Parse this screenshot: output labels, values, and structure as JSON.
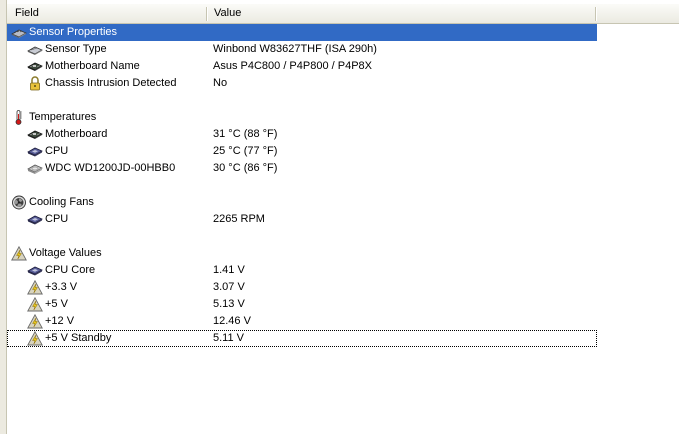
{
  "columns": {
    "field": "Field",
    "value": "Value"
  },
  "groups": [
    {
      "label": "Sensor Properties",
      "icon": "sensor-chip-icon",
      "selected": true,
      "items": [
        {
          "field": "Sensor Type",
          "value": "Winbond W83627THF  (ISA 290h)",
          "icon": "chip-icon"
        },
        {
          "field": "Motherboard Name",
          "value": "Asus P4C800 / P4P800 / P4P8X",
          "icon": "motherboard-icon"
        },
        {
          "field": "Chassis Intrusion Detected",
          "value": "No",
          "icon": "padlock-icon"
        }
      ]
    },
    {
      "label": "Temperatures",
      "icon": "thermometer-icon",
      "items": [
        {
          "field": "Motherboard",
          "value": "31 °C  (88 °F)",
          "icon": "motherboard-icon"
        },
        {
          "field": "CPU",
          "value": "25 °C  (77 °F)",
          "icon": "cpu-icon"
        },
        {
          "field": "WDC WD1200JD-00HBB0",
          "value": "30 °C  (86 °F)",
          "icon": "hard-disk-icon"
        }
      ]
    },
    {
      "label": "Cooling Fans",
      "icon": "fan-icon",
      "items": [
        {
          "field": "CPU",
          "value": "2265 RPM",
          "icon": "cpu-icon"
        }
      ]
    },
    {
      "label": "Voltage Values",
      "icon": "voltage-warning-icon",
      "items": [
        {
          "field": "CPU Core",
          "value": "1.41 V",
          "icon": "cpu-icon"
        },
        {
          "field": "+3.3 V",
          "value": "3.07 V",
          "icon": "voltage-warning-icon"
        },
        {
          "field": "+5 V",
          "value": "5.13 V",
          "icon": "voltage-warning-icon"
        },
        {
          "field": "+12 V",
          "value": "12.46 V",
          "icon": "voltage-warning-icon"
        },
        {
          "field": "+5 V Standby",
          "value": "5.11 V",
          "icon": "voltage-warning-icon",
          "focused": true
        }
      ]
    }
  ]
}
